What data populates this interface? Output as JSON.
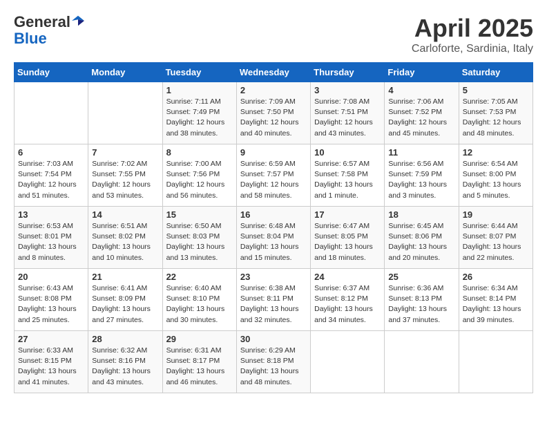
{
  "header": {
    "logo_line1": "General",
    "logo_line2": "Blue",
    "month": "April 2025",
    "location": "Carloforte, Sardinia, Italy"
  },
  "days_of_week": [
    "Sunday",
    "Monday",
    "Tuesday",
    "Wednesday",
    "Thursday",
    "Friday",
    "Saturday"
  ],
  "weeks": [
    [
      {
        "day": "",
        "info": ""
      },
      {
        "day": "",
        "info": ""
      },
      {
        "day": "1",
        "info": "Sunrise: 7:11 AM\nSunset: 7:49 PM\nDaylight: 12 hours\nand 38 minutes."
      },
      {
        "day": "2",
        "info": "Sunrise: 7:09 AM\nSunset: 7:50 PM\nDaylight: 12 hours\nand 40 minutes."
      },
      {
        "day": "3",
        "info": "Sunrise: 7:08 AM\nSunset: 7:51 PM\nDaylight: 12 hours\nand 43 minutes."
      },
      {
        "day": "4",
        "info": "Sunrise: 7:06 AM\nSunset: 7:52 PM\nDaylight: 12 hours\nand 45 minutes."
      },
      {
        "day": "5",
        "info": "Sunrise: 7:05 AM\nSunset: 7:53 PM\nDaylight: 12 hours\nand 48 minutes."
      }
    ],
    [
      {
        "day": "6",
        "info": "Sunrise: 7:03 AM\nSunset: 7:54 PM\nDaylight: 12 hours\nand 51 minutes."
      },
      {
        "day": "7",
        "info": "Sunrise: 7:02 AM\nSunset: 7:55 PM\nDaylight: 12 hours\nand 53 minutes."
      },
      {
        "day": "8",
        "info": "Sunrise: 7:00 AM\nSunset: 7:56 PM\nDaylight: 12 hours\nand 56 minutes."
      },
      {
        "day": "9",
        "info": "Sunrise: 6:59 AM\nSunset: 7:57 PM\nDaylight: 12 hours\nand 58 minutes."
      },
      {
        "day": "10",
        "info": "Sunrise: 6:57 AM\nSunset: 7:58 PM\nDaylight: 13 hours\nand 1 minute."
      },
      {
        "day": "11",
        "info": "Sunrise: 6:56 AM\nSunset: 7:59 PM\nDaylight: 13 hours\nand 3 minutes."
      },
      {
        "day": "12",
        "info": "Sunrise: 6:54 AM\nSunset: 8:00 PM\nDaylight: 13 hours\nand 5 minutes."
      }
    ],
    [
      {
        "day": "13",
        "info": "Sunrise: 6:53 AM\nSunset: 8:01 PM\nDaylight: 13 hours\nand 8 minutes."
      },
      {
        "day": "14",
        "info": "Sunrise: 6:51 AM\nSunset: 8:02 PM\nDaylight: 13 hours\nand 10 minutes."
      },
      {
        "day": "15",
        "info": "Sunrise: 6:50 AM\nSunset: 8:03 PM\nDaylight: 13 hours\nand 13 minutes."
      },
      {
        "day": "16",
        "info": "Sunrise: 6:48 AM\nSunset: 8:04 PM\nDaylight: 13 hours\nand 15 minutes."
      },
      {
        "day": "17",
        "info": "Sunrise: 6:47 AM\nSunset: 8:05 PM\nDaylight: 13 hours\nand 18 minutes."
      },
      {
        "day": "18",
        "info": "Sunrise: 6:45 AM\nSunset: 8:06 PM\nDaylight: 13 hours\nand 20 minutes."
      },
      {
        "day": "19",
        "info": "Sunrise: 6:44 AM\nSunset: 8:07 PM\nDaylight: 13 hours\nand 22 minutes."
      }
    ],
    [
      {
        "day": "20",
        "info": "Sunrise: 6:43 AM\nSunset: 8:08 PM\nDaylight: 13 hours\nand 25 minutes."
      },
      {
        "day": "21",
        "info": "Sunrise: 6:41 AM\nSunset: 8:09 PM\nDaylight: 13 hours\nand 27 minutes."
      },
      {
        "day": "22",
        "info": "Sunrise: 6:40 AM\nSunset: 8:10 PM\nDaylight: 13 hours\nand 30 minutes."
      },
      {
        "day": "23",
        "info": "Sunrise: 6:38 AM\nSunset: 8:11 PM\nDaylight: 13 hours\nand 32 minutes."
      },
      {
        "day": "24",
        "info": "Sunrise: 6:37 AM\nSunset: 8:12 PM\nDaylight: 13 hours\nand 34 minutes."
      },
      {
        "day": "25",
        "info": "Sunrise: 6:36 AM\nSunset: 8:13 PM\nDaylight: 13 hours\nand 37 minutes."
      },
      {
        "day": "26",
        "info": "Sunrise: 6:34 AM\nSunset: 8:14 PM\nDaylight: 13 hours\nand 39 minutes."
      }
    ],
    [
      {
        "day": "27",
        "info": "Sunrise: 6:33 AM\nSunset: 8:15 PM\nDaylight: 13 hours\nand 41 minutes."
      },
      {
        "day": "28",
        "info": "Sunrise: 6:32 AM\nSunset: 8:16 PM\nDaylight: 13 hours\nand 43 minutes."
      },
      {
        "day": "29",
        "info": "Sunrise: 6:31 AM\nSunset: 8:17 PM\nDaylight: 13 hours\nand 46 minutes."
      },
      {
        "day": "30",
        "info": "Sunrise: 6:29 AM\nSunset: 8:18 PM\nDaylight: 13 hours\nand 48 minutes."
      },
      {
        "day": "",
        "info": ""
      },
      {
        "day": "",
        "info": ""
      },
      {
        "day": "",
        "info": ""
      }
    ]
  ]
}
